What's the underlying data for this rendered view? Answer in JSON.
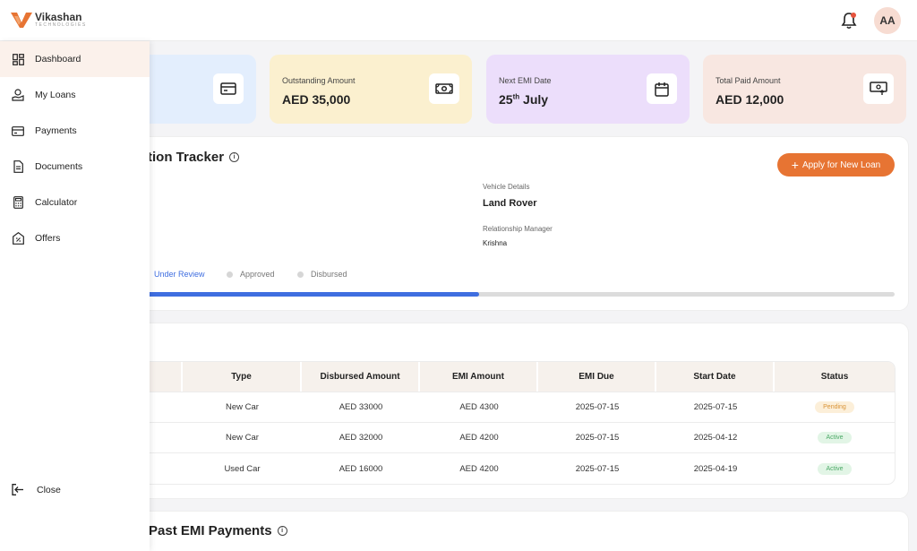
{
  "brand": {
    "name": "Vikashan",
    "tagline": "TECHNOLOGIES",
    "accent": "#e77433"
  },
  "header": {
    "avatar_initials": "AA"
  },
  "stats": [
    {
      "label": "",
      "value": ""
    },
    {
      "label": "Outstanding Amount",
      "value": "AED 35,000"
    },
    {
      "label": "Next EMI Date",
      "value_main": "25",
      "value_sup": "th",
      "value_rest": " July"
    },
    {
      "label": "Total Paid Amount",
      "value": "AED 12,000"
    }
  ],
  "tracker": {
    "title": "tion Tracker",
    "apply_button": "Apply for New Loan",
    "vehicle_label": "Vehicle Details",
    "vehicle_value": "Land Rover",
    "manager_label": "Relationship Manager",
    "manager_value": "Krishna",
    "steps": [
      "Under Review",
      "Approved",
      "Disbursed"
    ],
    "progress": 0.45
  },
  "loans": {
    "columns": [
      "",
      "Type",
      "Disbursed Amount",
      "EMI Amount",
      "EMI Due",
      "Start Date",
      "Status"
    ],
    "rows": [
      {
        "type": "New Car",
        "disbursed": "AED 33000",
        "emi": "AED 4300",
        "due": "2025-07-15",
        "start": "2025-07-15",
        "status": "Pending"
      },
      {
        "type": "New Car",
        "disbursed": "AED 32000",
        "emi": "AED 4200",
        "due": "2025-07-15",
        "start": "2025-04-12",
        "status": "Active"
      },
      {
        "type": "Used Car",
        "disbursed": "AED 16000",
        "emi": "AED 4200",
        "due": "2025-07-15",
        "start": "2025-04-19",
        "status": "Active"
      }
    ]
  },
  "past": {
    "title": "Past EMI Payments"
  },
  "sidebar": {
    "items": [
      {
        "label": "Dashboard",
        "icon": "dashboard-icon"
      },
      {
        "label": "My Loans",
        "icon": "loans-icon"
      },
      {
        "label": "Payments",
        "icon": "card-icon"
      },
      {
        "label": "Documents",
        "icon": "document-icon"
      },
      {
        "label": "Calculator",
        "icon": "calculator-icon"
      },
      {
        "label": "Offers",
        "icon": "offers-icon"
      }
    ],
    "close_label": "Close"
  }
}
